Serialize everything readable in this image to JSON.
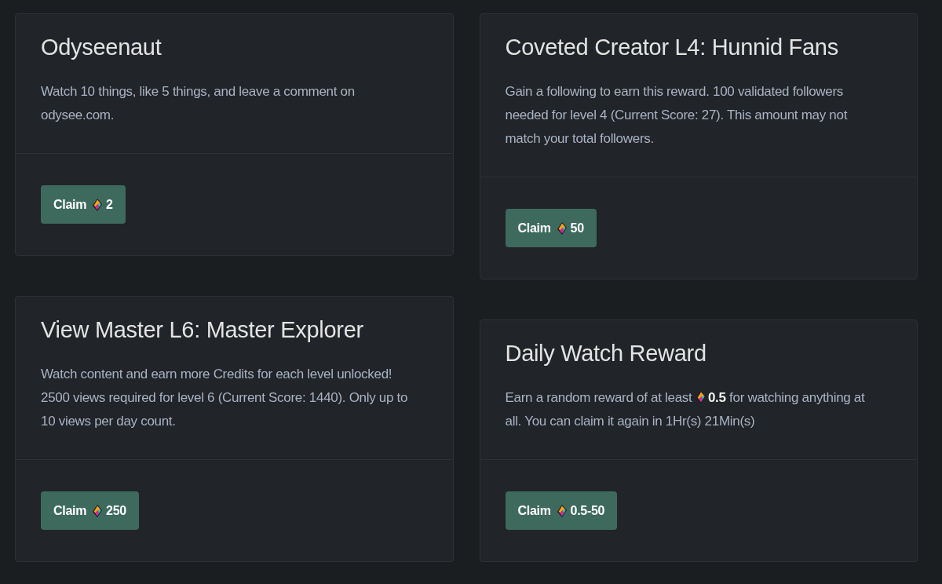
{
  "rewards": [
    {
      "title": "Odyseenaut",
      "description": [
        {
          "kind": "text",
          "text": "Watch 10 things, like 5 things, and leave a comment on odysee.com."
        }
      ],
      "claim_button": {
        "label": "Claim",
        "amount": "2"
      }
    },
    {
      "title": "Coveted Creator L4: Hunnid Fans",
      "description": [
        {
          "kind": "text",
          "text": "Gain a following to earn this reward. 100 validated followers needed for level 4 (Current Score: 27). This amount may not match your total followers."
        }
      ],
      "claim_button": {
        "label": "Claim",
        "amount": "50"
      }
    },
    {
      "title": "View Master L6: Master Explorer",
      "description": [
        {
          "kind": "text",
          "text": "Watch content and earn more Credits for each level unlocked! 2500 views required for level 6 (Current Score: 1440). Only up to 10 views per day count."
        }
      ],
      "claim_button": {
        "label": "Claim",
        "amount": "250"
      }
    },
    {
      "title": "Daily Watch Reward",
      "description": [
        {
          "kind": "text",
          "text": "Earn a random reward of at least"
        },
        {
          "kind": "credits",
          "amount": "0.5"
        },
        {
          "kind": "text",
          "text": "for watching anything at all. You can claim it again in 1Hr(s) 21Min(s)"
        }
      ],
      "claim_button": {
        "label": "Claim",
        "amount": "0.5-50"
      }
    }
  ]
}
